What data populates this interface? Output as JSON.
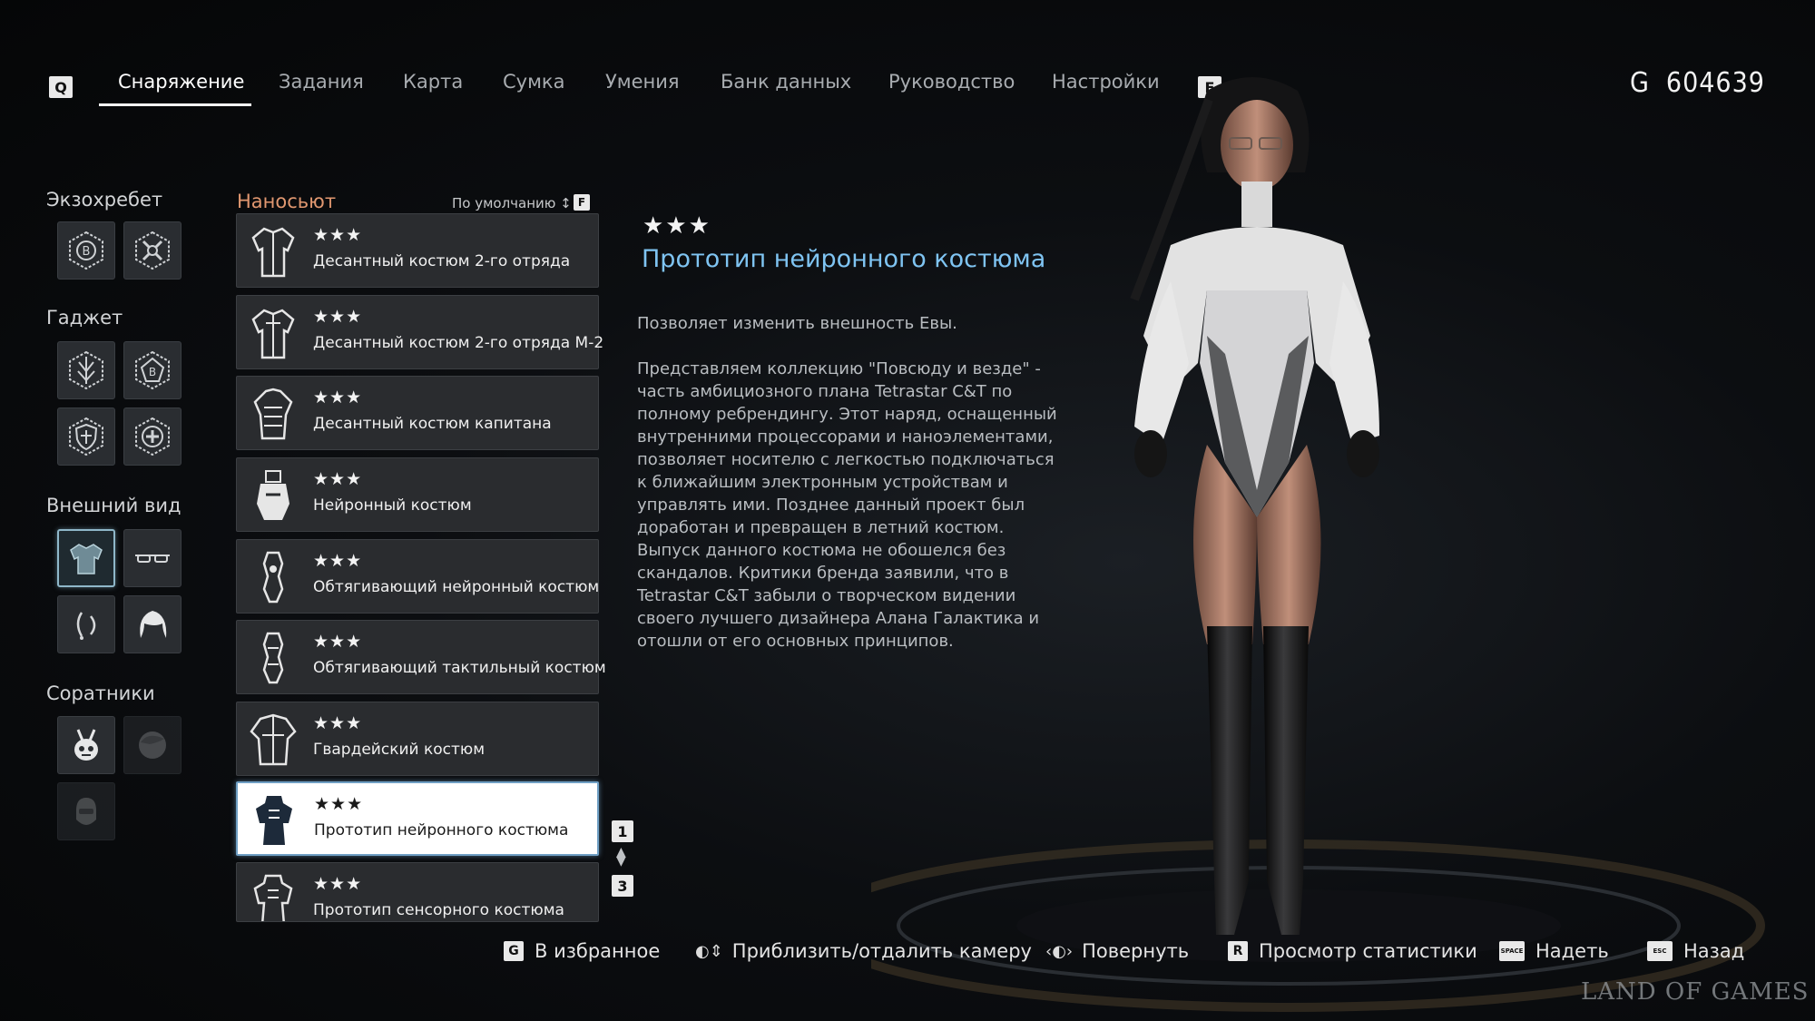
{
  "nav": {
    "prev_key": "Q",
    "next_key": "E",
    "tabs": [
      {
        "label": "Снаряжение",
        "active": true
      },
      {
        "label": "Задания",
        "active": false
      },
      {
        "label": "Карта",
        "active": false
      },
      {
        "label": "Сумка",
        "active": false
      },
      {
        "label": "Умения",
        "active": false
      },
      {
        "label": "Банк данных",
        "active": false
      },
      {
        "label": "Руководство",
        "active": false
      },
      {
        "label": "Настройки",
        "active": false
      }
    ]
  },
  "currency": {
    "symbol": "G",
    "amount": "604639"
  },
  "categories": {
    "exospine": {
      "label": "Экзохребет",
      "slots": [
        "exospine-b-icon",
        "exospine-cross-icon"
      ]
    },
    "gadget": {
      "label": "Гаджет",
      "slots": [
        "gadget-spike-icon",
        "gadget-b-icon",
        "gadget-shield-icon",
        "gadget-heal-icon"
      ]
    },
    "appearance": {
      "label": "Внешний вид",
      "slots": [
        "suit-icon",
        "glasses-icon",
        "earrings-icon",
        "hair-icon"
      ],
      "selected": 0
    },
    "companions": {
      "label": "Соратники",
      "slots": [
        "drone-icon",
        "adam-icon",
        "lily-icon"
      ]
    }
  },
  "list": {
    "header": "Наносьют",
    "sort_label": "По умолчанию ↕",
    "sort_key": "F",
    "selected_index": 7,
    "items": [
      {
        "stars": "★★★",
        "name": "Десантный костюм 2-го отряда"
      },
      {
        "stars": "★★★",
        "name": "Десантный костюм 2-го отряда М-2"
      },
      {
        "stars": "★★★",
        "name": "Десантный костюм капитана"
      },
      {
        "stars": "★★★",
        "name": "Нейронный костюм"
      },
      {
        "stars": "★★★",
        "name": "Обтягивающий нейронный костюм"
      },
      {
        "stars": "★★★",
        "name": "Обтягивающий тактильный костюм"
      },
      {
        "stars": "★★★",
        "name": "Гвардейский костюм"
      },
      {
        "stars": "★★★",
        "name": "Прототип нейронного костюма"
      },
      {
        "stars": "★★★",
        "name": "Прототип сенсорного костюма"
      }
    ],
    "page_current": "1",
    "page_total": "3"
  },
  "detail": {
    "stars": "★★★",
    "title": "Прототип нейронного костюма",
    "paragraph1": "Позволяет изменить внешность Евы.",
    "paragraph2": "Представляем коллекцию \"Повсюду и везде\" - часть амбициозного плана Tetrastar C&T по полному ребрендингу. Этот наряд, оснащенный внутренними процессорами и наноэлементами, позволяет носителю с легкостью подключаться к ближайшим электронным устройствам и управлять ими. Позднее данный проект был доработан и превращен в летний костюм. Выпуск данного костюма не обошелся без скандалов. Критики бренда заявили, что в Tetrastar C&T забыли о творческом видении своего лучшего дизайнера Алана Галактика и отошли от его основных принципов."
  },
  "prompts": [
    {
      "key": "G",
      "label": "В избранное"
    },
    {
      "key": "mouse-scroll-icon",
      "label": "Приблизить/отдалить камеру"
    },
    {
      "key": "mouse-drag-icon",
      "label": "Повернуть"
    },
    {
      "key": "R",
      "label": "Просмотр статистики"
    },
    {
      "key": "SPACE",
      "label": "Надеть"
    },
    {
      "key": "ESC",
      "label": "Назад"
    }
  ],
  "watermark": "LAND OF GAMES",
  "colors": {
    "title_blue": "#7fc4f2",
    "list_header_orange": "#e09770",
    "selected_border": "#6f9fc4"
  }
}
